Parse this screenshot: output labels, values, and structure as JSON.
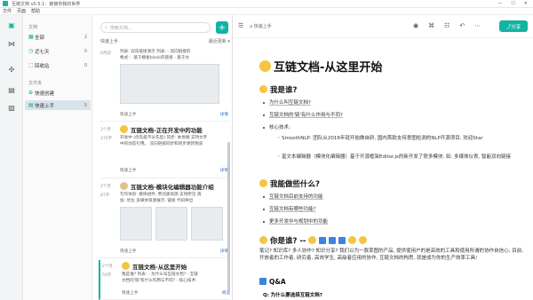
{
  "window": {
    "title": " 互链文档 v0.5.1：链接你我的世界",
    "controls": [
      "—",
      "☐",
      "✕"
    ]
  },
  "menu": [
    "文件",
    "页面",
    "帮助"
  ],
  "sidebar": {
    "library_label": "文档",
    "items": [
      {
        "icon": "▦",
        "label": "全部",
        "count": "2"
      },
      {
        "icon": "◷",
        "label": "近七天",
        "count": "0"
      },
      {
        "icon": "⬚",
        "label": "回收站",
        "count": "0"
      }
    ],
    "folder_label": "文件夹",
    "folders": [
      {
        "icon": "⊕",
        "label": "快速创建",
        "count": ""
      },
      {
        "icon": "▤",
        "label": "快速上手",
        "count": "5"
      }
    ]
  },
  "list": {
    "search_placeholder": "搜索文档...",
    "add_label": "+",
    "folder_name": "快速上手",
    "sort_label": "最近更新",
    "cards": [
      {
        "date": "6月前",
        "title": "",
        "excerpt": "列表: 双向链接演示 列表: - 双向链接的",
        "excerpt2": "格式: - 基于模板block的链接 - 基于文",
        "folder": "快速上手",
        "time": "",
        "share": "详情"
      },
      {
        "date": "2个月",
        "date2": "276字",
        "title": "互链文档-正在开发中的功能",
        "excerpt": "开发中 (优先级不分先后) 同步: 本地端 支持文字",
        "excerpt2": "中的动态引用。 双向链接同步和同步更新预览",
        "folder": "快速上手",
        "time": "",
        "share": "详情"
      },
      {
        "date": "2个月",
        "date2": "87字",
        "title": "互链文档-模块化编辑器功能介绍",
        "excerpt": "写作体验: 模块组件, 原创类资源 支持所见 再",
        "excerpt2": "加: 优化 多媒体资源展示, 链接 代码导出",
        "folder": "快速上手",
        "time": "",
        "share": "详情"
      },
      {
        "date": "2个月",
        "date2": "56字",
        "title": "互链文档-从这里开始",
        "excerpt": "我是谁? 列表: - 为什么叫互链文档? - 互链",
        "excerpt2": "文档的'链'有什么作用与不同? - 核心技术:",
        "folder": "快速上手",
        "time": "",
        "share": "阅读"
      }
    ]
  },
  "editor": {
    "path": "快速上手",
    "share_label": "分享",
    "tools": [
      "◉",
      "⌘",
      "☷",
      "↶",
      "⋯"
    ],
    "doc": {
      "title": "互链文档-从这里开始",
      "s1": "我是谁?",
      "s1_items": [
        "为什么叫互链文档?",
        "互链文档的'链'有什么作用与不同?",
        "核心技术:"
      ],
      "s1_sub": [
        "SmoothNLP: 团队从2016年就开始做自研, 国内首款支持意图检测的NLP开源项目, 欢迎Star",
        "富文本编辑器（模块化编辑器）基于开源框架Editor.js的新开发了很多模块, 如: 多媒体仪表, 智能双向链接"
      ],
      "s2": "我能做些什么?",
      "s2_items": [
        "互链文档目前支持的功能",
        "互链文档有哪些功能?",
        "更多开发中与规划中的功能"
      ],
      "s3": "你是谁? -- ",
      "s3_para": "笔记? 知识库? 多人协作? 知识分享? 我们以为一款草图的产品, 提供使用户的是高效的工具和使用所谓的协作自信心; 目前, 开放者的工作者, 研究者, 高效学生, 高级者应用的协作, 互链文档的构思, 就是成为你的生产效率工具!",
      "s4": "Q&A",
      "s5": "为什么要选择互链文档?"
    }
  },
  "colors": {
    "accent": "#13b3a3",
    "link": "#1b6fd0"
  }
}
